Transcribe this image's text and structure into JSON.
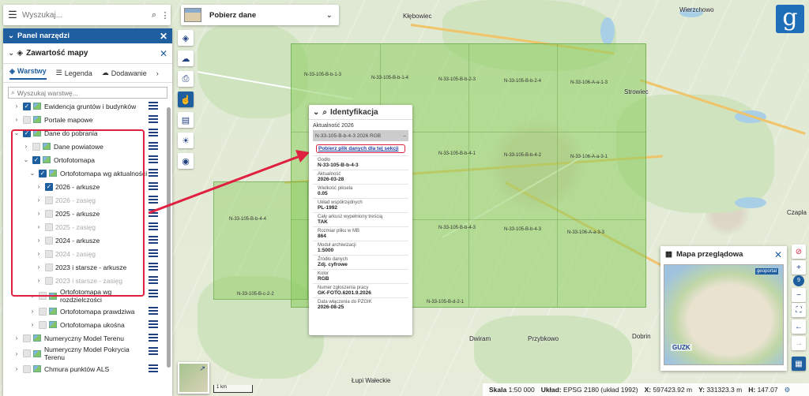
{
  "search": {
    "placeholder": "Wyszukaj..."
  },
  "panel": {
    "title": "Panel narzędzi",
    "section_title": "Zawartość mapy",
    "tabs": [
      {
        "label": "Warstwy"
      },
      {
        "label": "Legenda"
      },
      {
        "label": "Dodawanie"
      }
    ],
    "layer_search_placeholder": "Wyszukaj warstwę...",
    "tree": [
      {
        "label": "Ewidencja gruntów i budynków",
        "checked": true
      },
      {
        "label": "Portale mapowe",
        "checked": false
      },
      {
        "label": "Dane do pobrania",
        "checked": true
      },
      {
        "label": "Dane powiatowe",
        "checked": false
      },
      {
        "label": "Ortofotomapa",
        "checked": true
      },
      {
        "label": "Ortofotomapa wg aktualności",
        "checked": true
      },
      {
        "label": "2026 - arkusze",
        "checked": true
      },
      {
        "label": "2026 - zasięg",
        "checked": false
      },
      {
        "label": "2025 - arkusze",
        "checked": false
      },
      {
        "label": "2025 - zasięg",
        "checked": false
      },
      {
        "label": "2024 - arkusze",
        "checked": false
      },
      {
        "label": "2024 - zasięg",
        "checked": false
      },
      {
        "label": "2023 i starsze - arkusze",
        "checked": false
      },
      {
        "label": "2023 i starsze - zasięg",
        "checked": false
      },
      {
        "label": "Ortofotomapa wg rozdzielczości",
        "checked": false
      },
      {
        "label": "Ortofotomapa prawdziwa",
        "checked": false
      },
      {
        "label": "Ortofotomapa ukośna",
        "checked": false
      },
      {
        "label": "Numeryczny Model Terenu",
        "checked": false
      },
      {
        "label": "Numeryczny Model Pokrycia Terenu",
        "checked": false
      },
      {
        "label": "Chmura punktów ALS",
        "checked": false
      }
    ]
  },
  "dropdown": {
    "label": "Pobierz dane"
  },
  "identify": {
    "title": "Identyfikacja",
    "group": "Aktualność 2026",
    "selected": "N-33-105-B-b-4-3 2026 RGB",
    "selected_suffix": "–",
    "download_link": "Pobierz plik danych dla tej sekcji",
    "fields": [
      {
        "key": "Godło",
        "value": "N-33-105-B-b-4-3"
      },
      {
        "key": "Aktualność",
        "value": "2026-03-28"
      },
      {
        "key": "Wielkość piksela",
        "value": "0.05"
      },
      {
        "key": "Układ współrzędnych",
        "value": "PL-1992"
      },
      {
        "key": "Cały arkusz wypełniony treścią",
        "value": "TAK"
      },
      {
        "key": "Rozmiar pliku w MB",
        "value": "864"
      },
      {
        "key": "Moduł archiwizacji",
        "value": "1:5000"
      },
      {
        "key": "Źródło danych",
        "value": "Zdj. cyfrowe"
      },
      {
        "key": "Kolor",
        "value": "RGB"
      },
      {
        "key": "Numer zgłoszenia pracy",
        "value": "GK-FOTO.6201.9.2026"
      },
      {
        "key": "Data włączenia do PZGIK",
        "value": "2026-08-25"
      }
    ]
  },
  "map": {
    "sheets": [
      "N-33-105-B-b-1-3",
      "N-33-105-B-b-1-4",
      "N-33-105-B-b-2-3",
      "N-33-105-B-b-2-4",
      "N-33-106-A-a-1-3",
      "N-33-105-B-b-4-1",
      "N-33-105-B-b-4-2",
      "N-33-106-A-a-3-1",
      "N-33-105-B-b-4-4",
      "N-33-105-B-b-4-3",
      "N-33-105-B-b-4-3",
      "N-33-106-A-a-3-3",
      "N-33-105-B-c-2-2",
      "N-33-105-B-d-2-1"
    ],
    "places": [
      "Kłębowiec",
      "Przybkowo",
      "Dobrin",
      "Czapla",
      "Strowiec",
      "Dwiram",
      "Łupi Wałeckie",
      "Wierzchowo"
    ],
    "scalebar": "1 km"
  },
  "overview": {
    "title": "Mapa przeglądowa",
    "geoportal": "geoportal",
    "guzk": "GUZK"
  },
  "zoom_level": "9",
  "status": {
    "scale_label": "Skala",
    "scale_value": "1:50 000",
    "crs_label": "Układ:",
    "crs_value": "EPSG 2180 (układ 1992)",
    "x_label": "X:",
    "x_value": "597423.92 m",
    "y_label": "Y:",
    "y_value": "331323.3 m",
    "h_label": "H:",
    "h_value": "147.07"
  },
  "colors": {
    "brand": "#1f5f9f",
    "highlight": "#e02040",
    "ortho": "#8ccd5f"
  }
}
